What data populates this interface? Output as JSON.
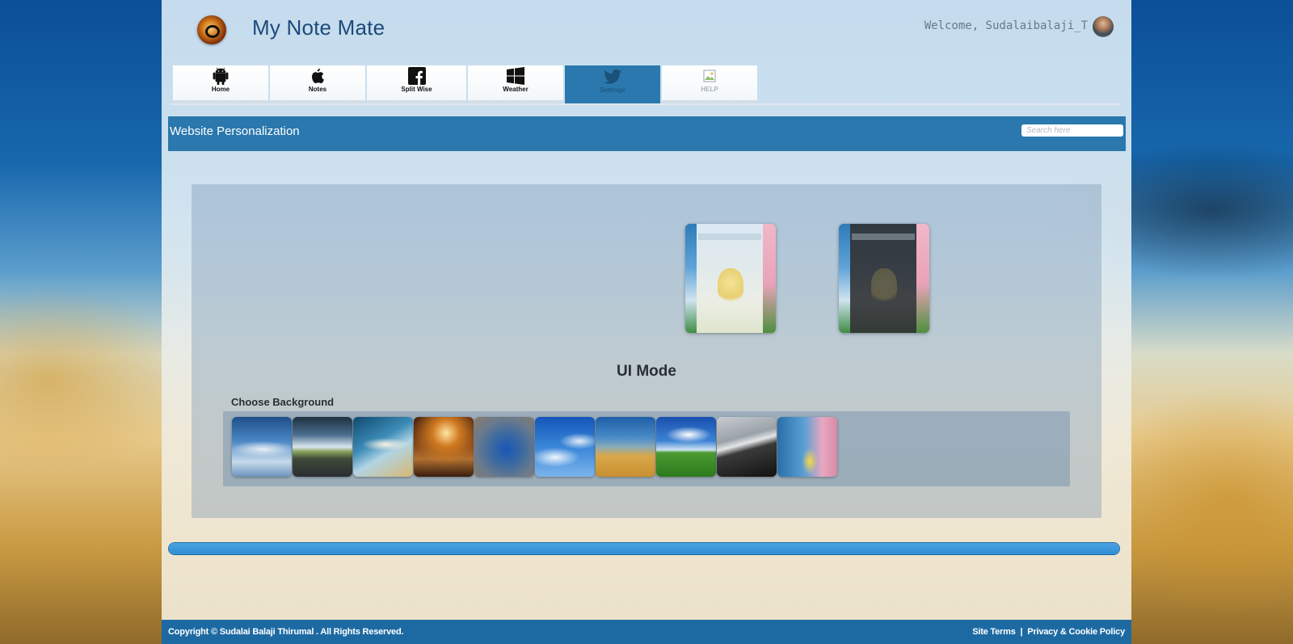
{
  "header": {
    "title": "My Note Mate",
    "welcome": "Welcome, Sudalaibalaji_T",
    "logo_icon": "app-logo",
    "avatar_icon": "user-avatar"
  },
  "tabs": [
    {
      "label": "Home",
      "icon": "android-icon"
    },
    {
      "label": "Notes",
      "icon": "apple-icon"
    },
    {
      "label": "Split Wise",
      "icon": "facebook-icon"
    },
    {
      "label": "Weather",
      "icon": "windows-icon"
    },
    {
      "label": "Settings",
      "icon": "twitter-icon",
      "active": true
    },
    {
      "label": "HELP",
      "icon": "broken-image-icon"
    }
  ],
  "section": {
    "title": "Website Personalization",
    "search_placeholder": "Search here"
  },
  "personalization": {
    "ui_mode_label": "UI Mode",
    "ui_modes": [
      "light-mode-preview",
      "dark-mode-preview"
    ],
    "choose_background_label": "Choose Background",
    "backgrounds": [
      "airplane-clouds",
      "airplane-runway",
      "airplane-sky",
      "wheat-field-sunset",
      "blurred-blue",
      "blue-sky-clouds",
      "blurred-field",
      "green-meadow-sky",
      "black-sand-beach",
      "pikachu-blossom"
    ]
  },
  "progress": {
    "value": 1.0
  },
  "footer": {
    "copyright": "Copyright © Sudalai Balaji Thirumal . All Rights Reserved.",
    "site_terms": "Site Terms",
    "separator": "|",
    "privacy": "Privacy & Cookie Policy"
  },
  "colors": {
    "accent": "#2a78ad",
    "footer": "#1d6aa3",
    "title": "#1d4a7a"
  }
}
